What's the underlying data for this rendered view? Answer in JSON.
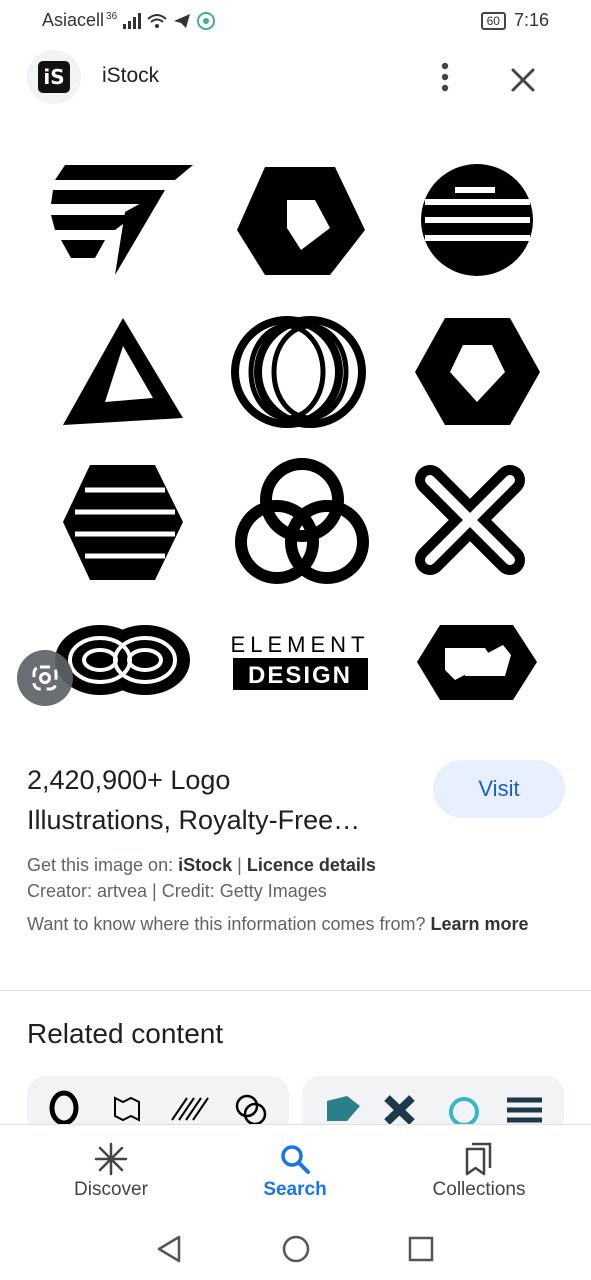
{
  "status_bar": {
    "carrier": "Asiacell",
    "network": "36",
    "battery": "60",
    "time": "7:16"
  },
  "header": {
    "site_name": "iStock",
    "logo_text": "iS"
  },
  "image": {
    "element_text_top": "ELEMENT",
    "element_text_bottom": "DESIGN"
  },
  "result": {
    "title_line1": "2,420,900+ Logo",
    "title_line2": "Illustrations, Royalty-Free…",
    "visit_label": "Visit",
    "get_image_prefix": "Get this image on:",
    "source": "iStock",
    "separator": "|",
    "licence": "Licence details",
    "creator_line": "Creator: artvea | Credit: Getty Images",
    "info_text": "Want to know where this information comes from?",
    "learn_more": "Learn more"
  },
  "related": {
    "title": "Related content"
  },
  "bottom_nav": {
    "discover": "Discover",
    "search": "Search",
    "collections": "Collections"
  },
  "colors": {
    "accent": "#1a73e8",
    "visit_bg": "#e8f0fe"
  }
}
